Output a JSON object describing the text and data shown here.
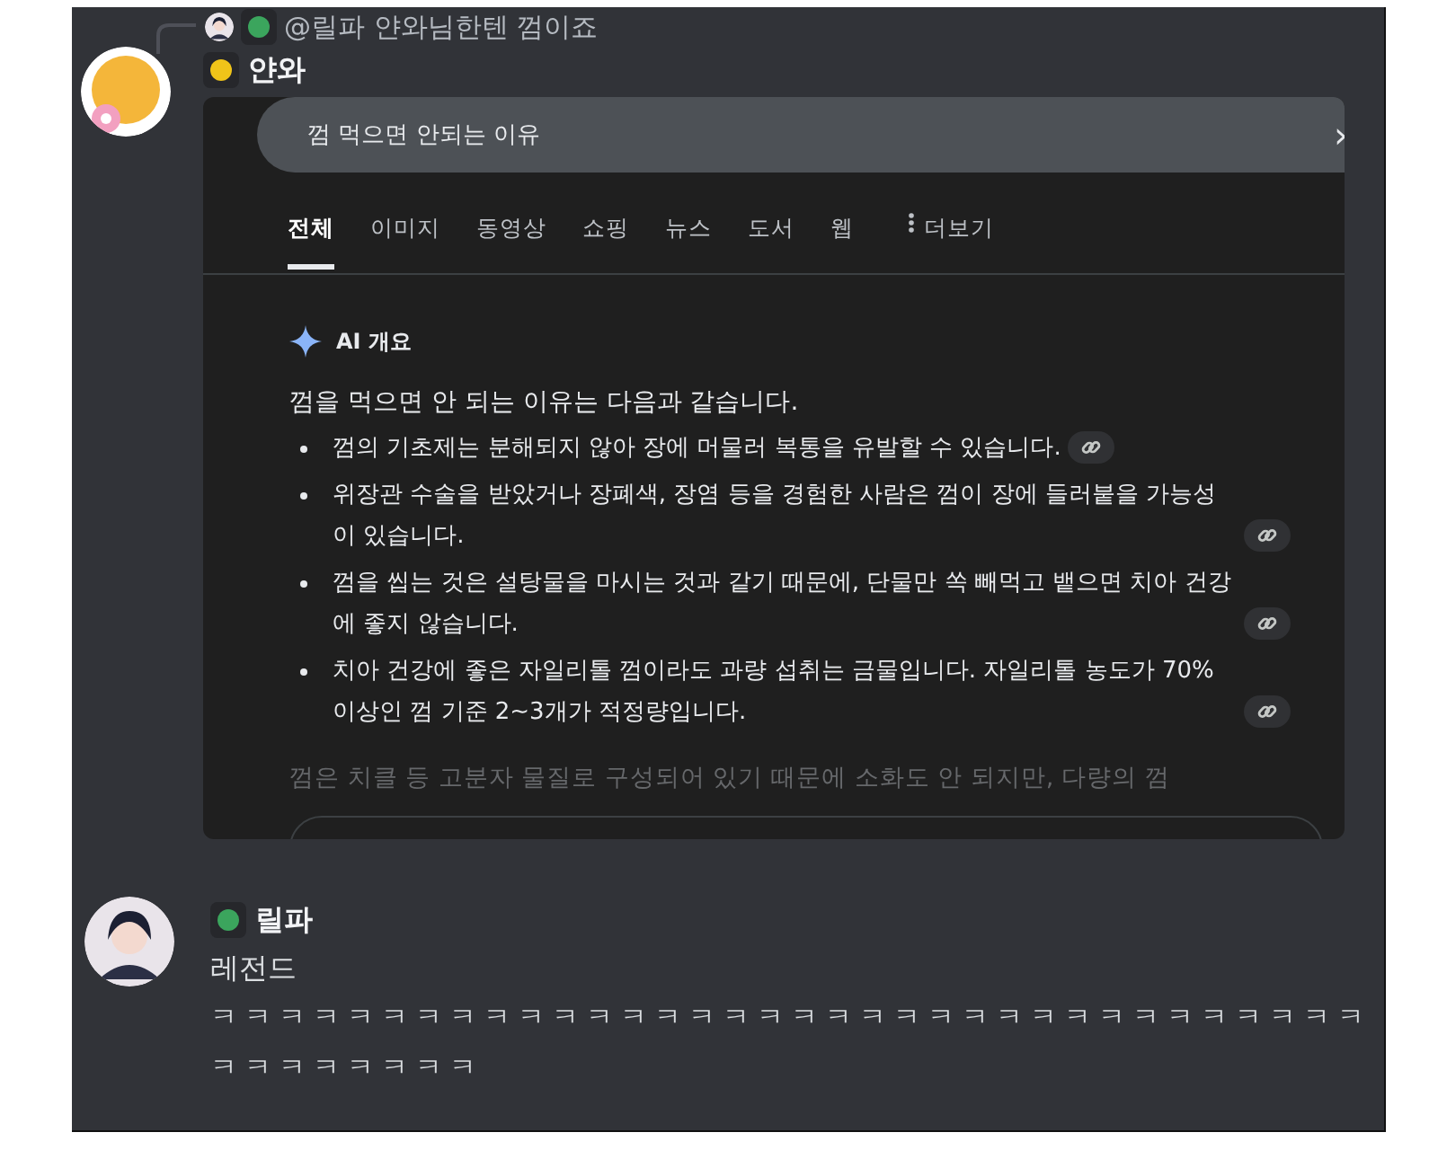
{
  "messages": [
    {
      "reply": {
        "color": "#3ba55d",
        "text": "@릴파 얀와님한텐 껌이죠"
      },
      "author": "얀와",
      "color": "#f0c419",
      "attachment": {
        "search": {
          "value": "껌 먹으면 안되는 이유",
          "arrow": "›"
        },
        "tabs": [
          {
            "label": "전체",
            "selected": true
          },
          {
            "label": "이미지",
            "selected": false
          },
          {
            "label": "동영상",
            "selected": false
          },
          {
            "label": "쇼핑",
            "selected": false
          },
          {
            "label": "뉴스",
            "selected": false
          },
          {
            "label": "도서",
            "selected": false
          },
          {
            "label": "웹",
            "selected": false
          }
        ],
        "more": "더보기",
        "overview": {
          "heading": "AI 개요",
          "intro": "껌을 먹으면 안 되는 이유는 다음과 같습니다.",
          "bullets": [
            "껌의 기초제는 분해되지 않아 장에 머물러 복통을 유발할 수 있습니다.",
            "위장관 수술을 받았거나 장폐색, 장염 등을 경험한 사람은 껌이 장에 들러붙을 가능성이 있습니다.",
            "껌을 씹는 것은 설탕물을 마시는 것과 같기 때문에, 단물만 쏙 빼먹고 뱉으면 치아 건강에 좋지 않습니다.",
            "치아 건강에 좋은 자일리톨 껌이라도 과량 섭취는 금물입니다. 자일리톨 농도가 70% 이상인 껌 기준 2~3개가 적정량입니다."
          ],
          "faded": "껌은 치클 등 고분자 물질로 구성되어 있기 때문에 소화도 안 되지만, 다량의 껌"
        }
      }
    },
    {
      "author": "릴파",
      "color": "#3ba55d",
      "lines": [
        "레전드",
        "ㅋㅋㅋㅋㅋㅋㅋㅋㅋㅋㅋㅋㅋㅋㅋㅋㅋㅋㅋㅋㅋㅋㅋㅋㅋㅋㅋㅋㅋㅋㅋㅋㅋㅋㅋㅋㅋㅋㅋㅋㅋㅋ"
      ]
    }
  ]
}
